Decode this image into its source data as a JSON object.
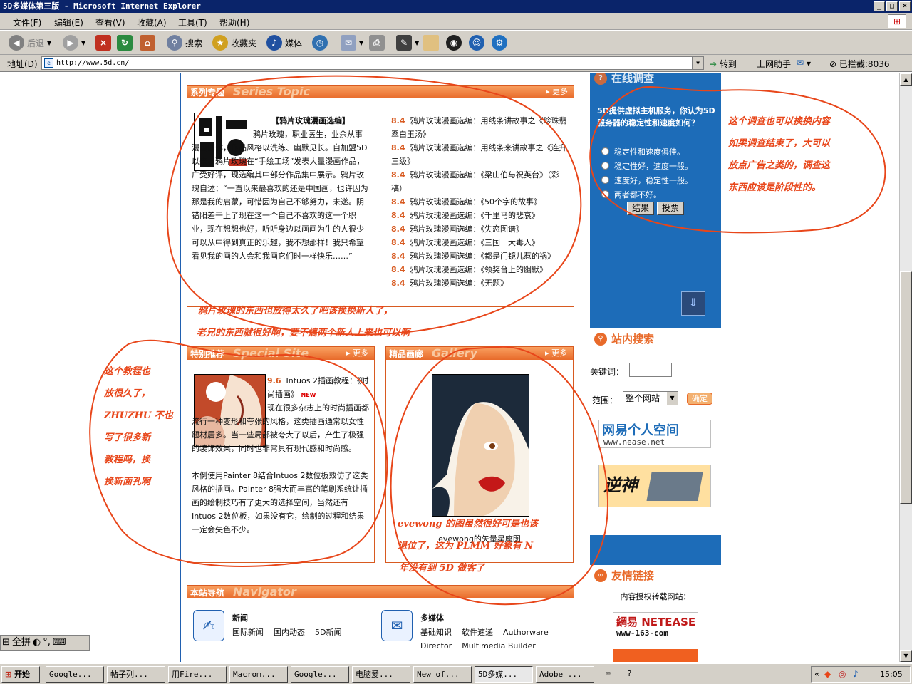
{
  "window": {
    "title": "5D多媒体第三版 - Microsoft Internet Explorer",
    "min": "_",
    "max": "□",
    "close": "×"
  },
  "menu": [
    "文件(F)",
    "编辑(E)",
    "查看(V)",
    "收藏(A)",
    "工具(T)",
    "帮助(H)"
  ],
  "toolbar": {
    "back": "后退",
    "search": "搜索",
    "favorites": "收藏夹",
    "media": "媒体"
  },
  "address": {
    "label": "地址(D)",
    "url": "http://www.5d.cn/",
    "go": "转到",
    "helper": "上网助手",
    "blocked": "已拦截:8036"
  },
  "series": {
    "title": "系列专题",
    "ghost": "Series Topic",
    "more": "更多",
    "article_title": "【鸦片玫瑰漫画选编】",
    "article_body": "鸦片玫瑰，职业医生，业余从事漫画创作，作品风格以洗练、幽默见长。自加盟5D以来，鸦片玫瑰在“手绘工场”发表大量漫画作品，广受好评，现选编其中部分作品集中展示。鸦片玫瑰自述：“一直以来最喜欢的还是中国画，也许因为那是我的启蒙，可惜因为自己不够努力，未遂。阴错阳差干上了现在这一个自己不喜欢的这一个职业，现在想想也好，听听身边以画画为生的人很少可以从中得到真正的乐趣，我不想那样！我只希望看见我的画的人会和我画它们时一样快乐……”",
    "items": [
      {
        "num": "8.4",
        "text": "鸦片玫瑰漫画选编：用线条讲故事之《珍珠翡翠白玉汤》"
      },
      {
        "num": "8.4",
        "text": "鸦片玫瑰漫画选编：用线条来讲故事之《连升三级》"
      },
      {
        "num": "8.4",
        "text": "鸦片玫瑰漫画选编：《梁山伯与祝英台》（彩稿）"
      },
      {
        "num": "8.4",
        "text": "鸦片玫瑰漫画选编：《50个字的故事》"
      },
      {
        "num": "8.4",
        "text": "鸦片玫瑰漫画选编：《千里马的悲哀》"
      },
      {
        "num": "8.4",
        "text": "鸦片玫瑰漫画选编：《失恋图谱》"
      },
      {
        "num": "8.4",
        "text": "鸦片玫瑰漫画选编：《三国十大毒人》"
      },
      {
        "num": "8.4",
        "text": "鸦片玫瑰漫画选编：《都是门镜儿惹的祸》"
      },
      {
        "num": "8.4",
        "text": "鸦片玫瑰漫画选编：《领奖台上的幽默》"
      },
      {
        "num": "8.4",
        "text": "鸦片玫瑰漫画选编：《无题》"
      }
    ]
  },
  "special": {
    "title": "特别推荐",
    "ghost": "Special Site",
    "more": "更多",
    "num": "9.6",
    "head": "Intuos 2插画教程：《时尚插画》",
    "new": "NEW",
    "body1": "现在很多杂志上的时尚插画都流行一种变形和夸张的风格，这类插画通常以女性题材居多。当一些局部被夸大了以后，产生了极强的装饰效果，同时也非常具有现代感和时尚感。",
    "body2": "本例使用Painter 8结合Intuos 2数位板效仿了这类风格的插画。Painter 8强大而丰富的笔刷系统让插画的绘制技巧有了更大的选择空间，当然还有Intuos 2数位板，如果没有它，绘制的过程和结果一定会失色不少。"
  },
  "gallery": {
    "title": "精品画廊",
    "ghost": "Gallery",
    "more": "更多",
    "caption": "evewong的矢量星座图"
  },
  "nav": {
    "title": "本站导航",
    "ghost": "Navigator",
    "news_title": "新闻",
    "news_links": [
      "国际新闻",
      "国内动态",
      "5D新闻"
    ],
    "mm_title": "多媒体",
    "mm_links": [
      "基础知识",
      "软件速递",
      "Authorware",
      "Director",
      "Multimedia Builder"
    ]
  },
  "poll": {
    "title": "在线调查",
    "question": "5D提供虚拟主机服务，你认为5D服务器的稳定性和速度如何？",
    "options": [
      "稳定性和速度俱佳。",
      "稳定性好，速度一般。",
      "速度好，稳定性一般。",
      "两者都不好。"
    ],
    "result_btn": "结果",
    "vote_btn": "投票"
  },
  "search": {
    "title": "站内搜索",
    "keyword_label": "关键词：",
    "range_label": "范围：",
    "range_value": "整个网站",
    "go": "确定"
  },
  "banners": {
    "nease_main": "网易个人空间",
    "nease_url": "www.nease.net",
    "god": "逆神"
  },
  "links": {
    "title": "友情链接",
    "caption": "内容授权转载网站：",
    "netease": "網易 NETEASE",
    "netease_url": "www-163-com"
  },
  "notes": {
    "n1a": "鸦片玫瑰的东西也放得太久了吧该换换新人了，",
    "n1b": "老兄的东西就很好啊，要不搞两个新人上来也可以啊",
    "n2": [
      "这个调查也可以换换内容",
      "如果调查结束了，大可以",
      "放点广告之类的，调查这",
      "东西应该是阶段性的。"
    ],
    "n3": [
      "这个教程也",
      "放很久了，",
      "ZHUZHU 不也",
      "写了很多新",
      "教程吗，换",
      "换新面孔啊"
    ],
    "n4": [
      "evewong 的图虽然很好可是也该",
      "退位了，这为 PLMM 好象有 N",
      "年没有到 5D 做客了"
    ]
  },
  "ime": {
    "mode": "全拼"
  },
  "taskbar": {
    "start": "开始",
    "tasks": [
      "Google...",
      "帖子列...",
      "用Fire...",
      "Macrom...",
      "Google...",
      "电脑爱...",
      "New of...",
      "5D多媒...",
      "Adobe ..."
    ],
    "clock": "15:05"
  },
  "colors": {
    "accent": "#e86a2a",
    "sidebar": "#1d6cb8",
    "note": "#e8461a"
  }
}
